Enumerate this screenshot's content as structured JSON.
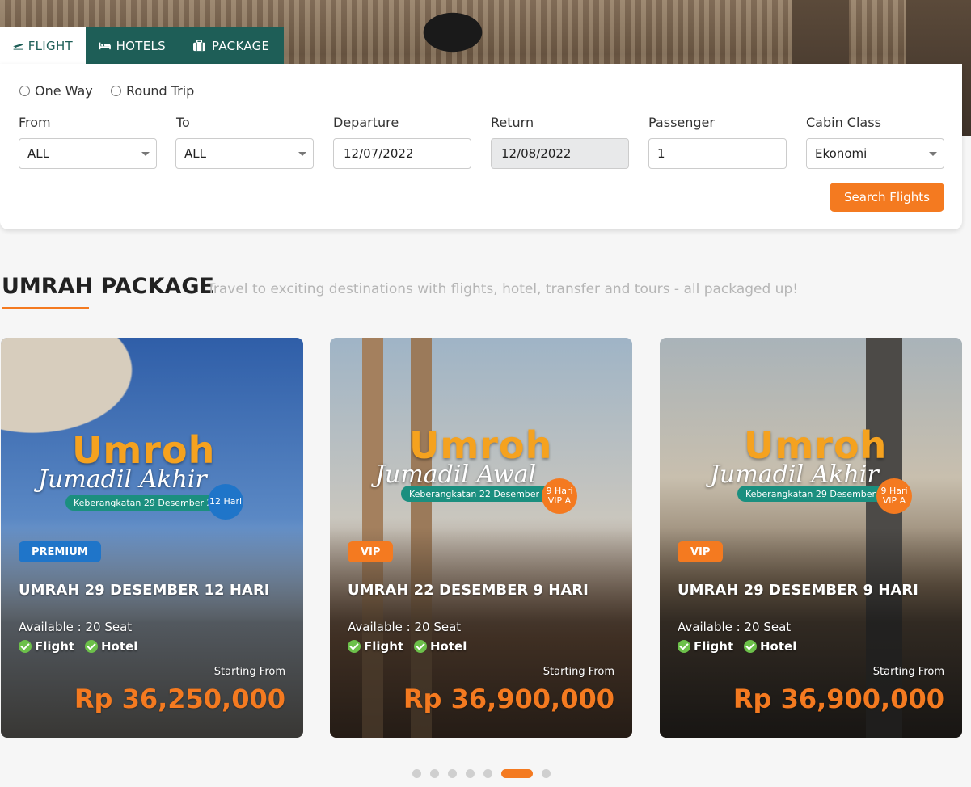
{
  "tabs": [
    {
      "label": "FLIGHT",
      "icon": "airplane-icon",
      "active": true
    },
    {
      "label": "HOTELS",
      "icon": "bed-icon",
      "active": false
    },
    {
      "label": "PACKAGE",
      "icon": "suitcase-icon",
      "active": false
    }
  ],
  "search": {
    "trip_types": [
      "One Way",
      "Round Trip"
    ],
    "from": {
      "label": "From",
      "value": "ALL"
    },
    "to": {
      "label": "To",
      "value": "ALL"
    },
    "departure": {
      "label": "Departure",
      "value": "12/07/2022"
    },
    "return": {
      "label": "Return",
      "value": "12/08/2022"
    },
    "passenger": {
      "label": "Passenger",
      "value": "1"
    },
    "cabin_class": {
      "label": "Cabin Class",
      "value": "Ekonomi"
    },
    "search_button": "Search Flights"
  },
  "section": {
    "title": "UMRAH PACKAGE",
    "subtitle": "Travel to exciting destinations with flights, hotel, transfer and tours - all packaged up!"
  },
  "packages": [
    {
      "poster_title": "Umroh",
      "poster_script": "Jumadil Akhir",
      "poster_ribbon": "Keberangkatan 29 Desember 2022",
      "poster_duration": "12 Hari",
      "badge": "PREMIUM",
      "badge_color": "#1f75c9",
      "name": "UMRAH 29 DESEMBER 12 HARI",
      "available": "Available : 20 Seat",
      "features": [
        "Flight",
        "Hotel"
      ],
      "starting_label": "Starting From",
      "price": "Rp 36,250,000"
    },
    {
      "poster_title": "Umroh",
      "poster_script": "Jumadil Awal",
      "poster_ribbon": "Keberangkatan 22 Desember 2022",
      "poster_duration": "9 Hari VIP A",
      "badge": "VIP",
      "badge_color": "#f47a20",
      "name": "UMRAH 22 DESEMBER 9 HARI",
      "available": "Available : 20 Seat",
      "features": [
        "Flight",
        "Hotel"
      ],
      "starting_label": "Starting From",
      "price": "Rp 36,900,000"
    },
    {
      "poster_title": "Umroh",
      "poster_script": "Jumadil Akhir",
      "poster_ribbon": "Keberangkatan 29 Desember 2022",
      "poster_duration": "9 Hari VIP A",
      "badge": "VIP",
      "badge_color": "#f47a20",
      "name": "UMRAH 29 DESEMBER 9 HARI",
      "available": "Available : 20 Seat",
      "features": [
        "Flight",
        "Hotel"
      ],
      "starting_label": "Starting From",
      "price": "Rp 36,900,000"
    }
  ],
  "carousel": {
    "total": 7,
    "active_index": 5
  },
  "colors": {
    "teal": "#1e5e57",
    "orange": "#f47a20",
    "blue": "#1f75c9",
    "check_green": "#6cc04a"
  }
}
